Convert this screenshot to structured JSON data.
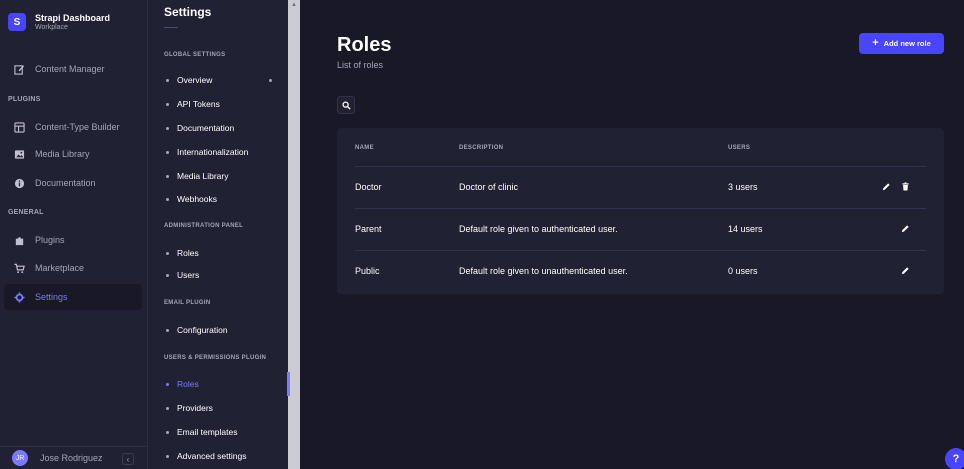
{
  "brand": {
    "title": "Strapi Dashboard",
    "subtitle": "Workplace",
    "logo": "S"
  },
  "mainnav": {
    "content_manager": "Content Manager",
    "plugins_section": "PLUGINS",
    "ctb": "Content-Type Builder",
    "media": "Media Library",
    "docs": "Documentation",
    "general_section": "GENERAL",
    "plugins": "Plugins",
    "marketplace": "Marketplace",
    "settings": "Settings"
  },
  "user": {
    "initials": "JR",
    "name": "Jose Rodriguez",
    "collapse_icon": "‹"
  },
  "subnav": {
    "title": "Settings",
    "global_section": "GLOBAL SETTINGS",
    "overview": "Overview",
    "api_tokens": "API Tokens",
    "documentation": "Documentation",
    "i18n": "Internationalization",
    "media_library": "Media Library",
    "webhooks": "Webhooks",
    "admin_section": "ADMINISTRATION PANEL",
    "admin_roles": "Roles",
    "admin_users": "Users",
    "email_section": "EMAIL PLUGIN",
    "configuration": "Configuration",
    "up_section": "USERS & PERMISSIONS PLUGIN",
    "up_roles": "Roles",
    "providers": "Providers",
    "email_templates": "Email templates",
    "advanced": "Advanced settings"
  },
  "page": {
    "title": "Roles",
    "subtitle": "List of roles",
    "add_button": "Add new role",
    "add_icon": "+"
  },
  "table": {
    "headers": {
      "name": "NAME",
      "description": "DESCRIPTION",
      "users": "USERS"
    },
    "rows": [
      {
        "name": "Doctor",
        "description": "Doctor of clinic",
        "users": "3 users"
      },
      {
        "name": "Parent",
        "description": "Default role given to authenticated user.",
        "users": "14 users"
      },
      {
        "name": "Public",
        "description": "Default role given to unauthenticated user.",
        "users": "0 users"
      }
    ]
  },
  "help": "?",
  "colors": {
    "primary": "#4945ff",
    "accent": "#7b79ff",
    "bg": "#181826",
    "panel": "#212134"
  }
}
